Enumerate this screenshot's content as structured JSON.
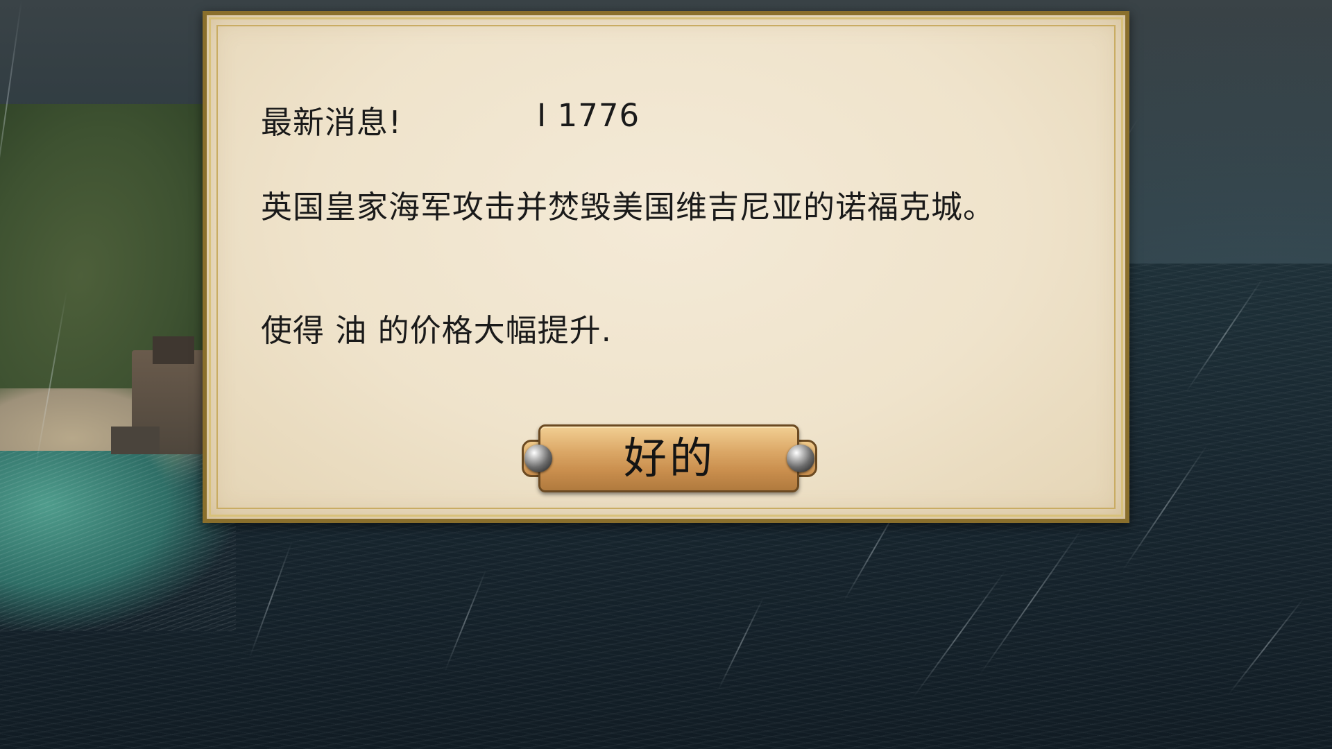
{
  "dialog": {
    "headline_title": "最新消息!",
    "headline_date": "I 1776",
    "news_body": "英国皇家海军攻击并焚毁美国维吉尼亚的诺福克城。",
    "effect_text": "使得 油 的价格大幅提升.",
    "ok_label": "好的"
  },
  "colors": {
    "parchment": "#efe3cb",
    "gold_frame": "#8a6f2c",
    "button_bronze": "#dba766"
  },
  "icons": {
    "left_rivet": "rivet-icon",
    "right_rivet": "rivet-icon"
  }
}
